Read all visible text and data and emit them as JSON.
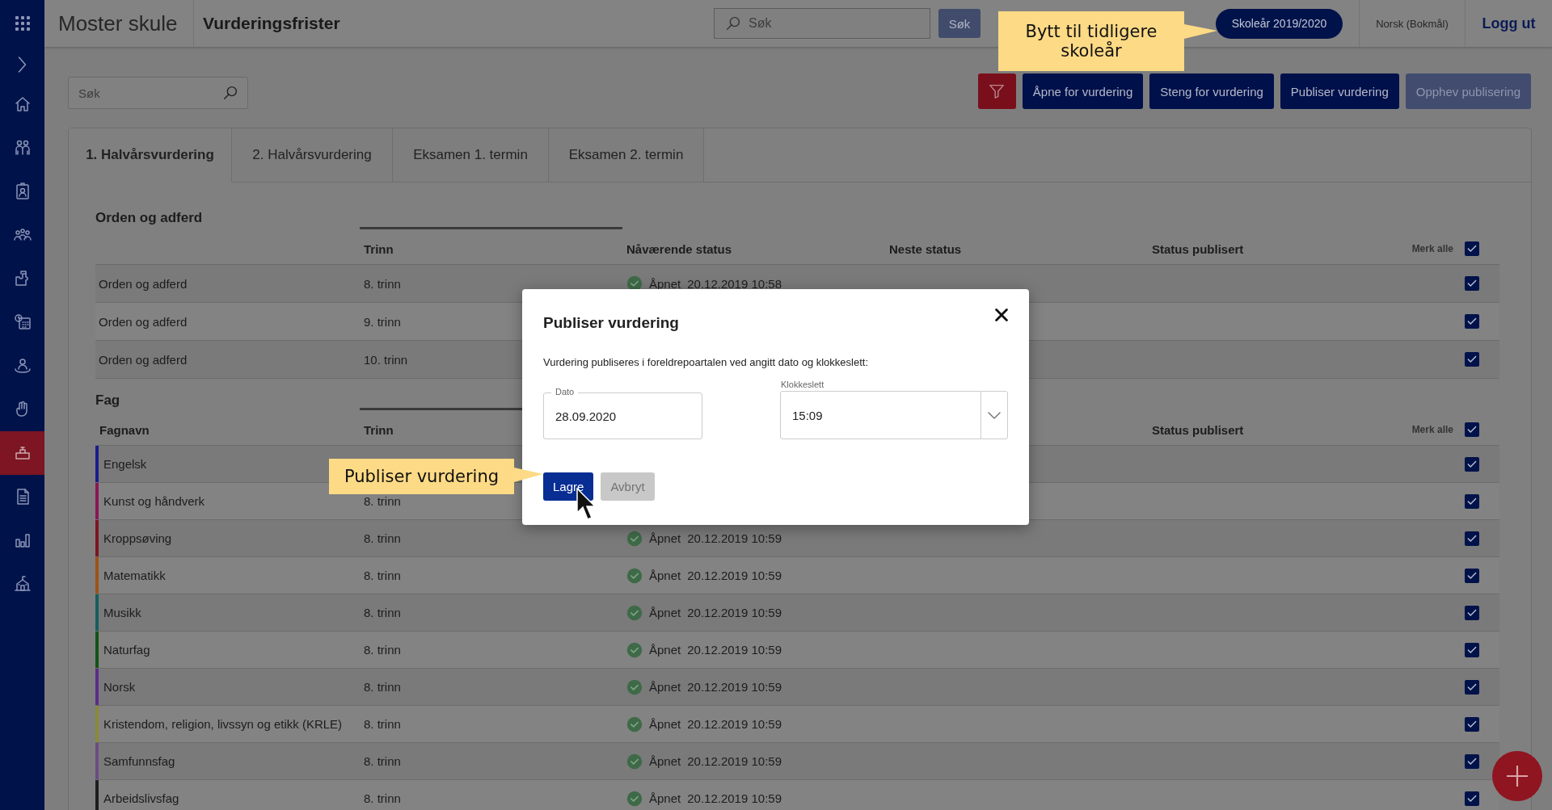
{
  "app": {
    "title": "Moster skule",
    "page_title": "Vurderingsfrister"
  },
  "top_search": {
    "placeholder": "Søk",
    "button": "Søk"
  },
  "school_year": "Skoleår 2019/2020",
  "language": "Norsk (Bokmål)",
  "logout": "Logg ut",
  "sidebar": {
    "items": [
      {
        "selected": false
      },
      {
        "selected": false
      },
      {
        "selected": false
      },
      {
        "selected": false
      },
      {
        "selected": false
      },
      {
        "selected": false
      },
      {
        "selected": false
      },
      {
        "selected": false
      },
      {
        "selected": true
      },
      {
        "selected": false
      },
      {
        "selected": false
      },
      {
        "selected": false
      }
    ]
  },
  "search": {
    "placeholder": "Søk"
  },
  "actions": [
    {
      "label": "Åpne for vurdering",
      "disabled": false
    },
    {
      "label": "Steng for vurdering",
      "disabled": false
    },
    {
      "label": "Publiser vurdering",
      "disabled": false
    },
    {
      "label": "Opphev publisering",
      "disabled": true
    }
  ],
  "tabs": [
    {
      "label": "1. Halvårsvurdering",
      "selected": true
    },
    {
      "label": "2. Halvårsvurdering",
      "selected": false
    },
    {
      "label": "Eksamen 1. termin",
      "selected": false
    },
    {
      "label": "Eksamen 2. termin",
      "selected": false
    }
  ],
  "sections": [
    {
      "title": "Orden og adferd",
      "columns": [
        {
          "kind": "grade",
          "label": "Trinn",
          "sorted": true
        },
        {
          "kind": "current",
          "label": "Nåværende status",
          "sorted": false
        },
        {
          "kind": "next",
          "label": "Neste status",
          "sorted": false
        },
        {
          "kind": "published",
          "label": "Status publisert",
          "sorted": false
        }
      ],
      "select_all": {
        "label": "Merk alle",
        "checked": true
      },
      "rows": [
        {
          "name": "Orden og adferd",
          "grade": "8. trinn",
          "status": {
            "label": "Åpnet",
            "time": "20.12.2019 10:58"
          },
          "checked": true
        },
        {
          "name": "Orden og adferd",
          "grade": "9. trinn",
          "checked": true
        },
        {
          "name": "Orden og adferd",
          "grade": "10. trinn",
          "checked": true
        }
      ]
    },
    {
      "title": "Fag",
      "columns": [
        {
          "kind": "name",
          "label": "Fagnavn",
          "sorted": false
        },
        {
          "kind": "grade",
          "label": "Trinn",
          "sorted": true
        },
        {
          "kind": "published",
          "label": "Status publisert",
          "sorted": false
        }
      ],
      "select_all": {
        "label": "Merk alle",
        "checked": true
      },
      "rows": [
        {
          "name": "Engelsk",
          "color": "#1c1c8c",
          "checked": true
        },
        {
          "name": "Kunst og håndverk",
          "color": "#8c1456",
          "grade": "8. trinn",
          "checked": true
        },
        {
          "name": "Kroppsøving",
          "color": "#7e1422",
          "grade": "8. trinn",
          "status": {
            "label": "Åpnet",
            "time": "20.12.2019 10:59"
          },
          "checked": true
        },
        {
          "name": "Matematikk",
          "color": "#9c5418",
          "grade": "8. trinn",
          "status": {
            "label": "Åpnet",
            "time": "20.12.2019 10:59"
          },
          "checked": true
        },
        {
          "name": "Musikk",
          "color": "#155e5e",
          "grade": "8. trinn",
          "status": {
            "label": "Åpnet",
            "time": "20.12.2019 10:59"
          },
          "checked": true
        },
        {
          "name": "Naturfag",
          "color": "#135416",
          "grade": "8. trinn",
          "status": {
            "label": "Åpnet",
            "time": "20.12.2019 10:59"
          },
          "checked": true
        },
        {
          "name": "Norsk",
          "color": "#5c2c88",
          "grade": "8. trinn",
          "status": {
            "label": "Åpnet",
            "time": "20.12.2019 10:59"
          },
          "checked": true
        },
        {
          "name": "Kristendom, religion, livssyn og etikk (KRLE)",
          "color": "#8a8a3a",
          "grade": "8. trinn",
          "status": {
            "label": "Åpnet",
            "time": "20.12.2019 10:59"
          },
          "checked": true
        },
        {
          "name": "Samfunnsfag",
          "color": "#6a4c86",
          "grade": "8. trinn",
          "status": {
            "label": "Åpnet",
            "time": "20.12.2019 10:59"
          },
          "checked": true
        },
        {
          "name": "Arbeidslivsfag",
          "color": "#1e1e1e",
          "grade": "8. trinn",
          "status": {
            "label": "Åpnet",
            "time": "20.12.2019 10:59"
          },
          "checked": true
        }
      ]
    }
  ],
  "dialog": {
    "title": "Publiser vurdering",
    "description": "Vurdering publiseres i foreldrepoartalen ved angitt dato og klokkeslett:",
    "date": {
      "label": "Dato",
      "value": "28.09.2020"
    },
    "time": {
      "label": "Klokkeslett",
      "value": "15:09"
    },
    "buttons": [
      {
        "label": "Lagre",
        "kind": "primary"
      },
      {
        "label": "Avbryt",
        "kind": "secondary"
      }
    ]
  },
  "callouts": [
    {
      "text": "Bytt til tidligere skoleår"
    },
    {
      "text": "Publiser vurdering"
    }
  ]
}
